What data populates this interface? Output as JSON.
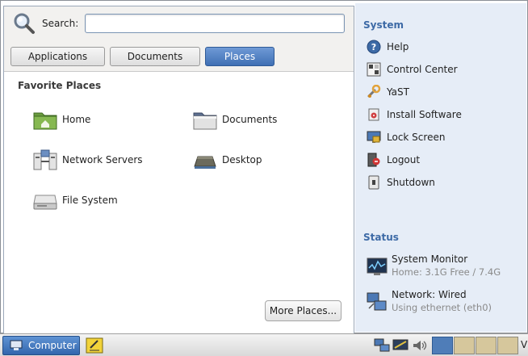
{
  "search": {
    "label": "Search:",
    "value": ""
  },
  "tabs": [
    {
      "label": "Applications"
    },
    {
      "label": "Documents"
    },
    {
      "label": "Places"
    }
  ],
  "favorites": {
    "title": "Favorite Places",
    "items": [
      {
        "label": "Home",
        "icon": "home-folder-icon"
      },
      {
        "label": "Documents",
        "icon": "documents-folder-icon"
      },
      {
        "label": "Network Servers",
        "icon": "network-servers-icon"
      },
      {
        "label": "Desktop",
        "icon": "desktop-icon"
      },
      {
        "label": "File System",
        "icon": "file-system-drive-icon"
      }
    ],
    "more_label": "More Places..."
  },
  "system": {
    "title": "System",
    "items": [
      {
        "label": "Help",
        "icon": "help-icon"
      },
      {
        "label": "Control Center",
        "icon": "control-center-icon"
      },
      {
        "label": "YaST",
        "icon": "yast-icon"
      },
      {
        "label": "Install Software",
        "icon": "install-software-icon"
      },
      {
        "label": "Lock Screen",
        "icon": "lock-screen-icon"
      },
      {
        "label": "Logout",
        "icon": "logout-icon"
      },
      {
        "label": "Shutdown",
        "icon": "shutdown-icon"
      }
    ]
  },
  "status": {
    "title": "Status",
    "monitor": {
      "label": "System Monitor",
      "detail": "Home: 3.1G Free / 7.4G"
    },
    "network": {
      "label": "Network: Wired",
      "detail": "Using ethernet (eth0)"
    }
  },
  "taskbar": {
    "computer_label": "Computer",
    "trailing_text": "V",
    "workspaces": 4,
    "active_workspace": 1
  },
  "colors": {
    "accent": "#3f6fb4",
    "section_heading": "#3d6aa6",
    "right_pane_bg": "#e6edf7"
  }
}
